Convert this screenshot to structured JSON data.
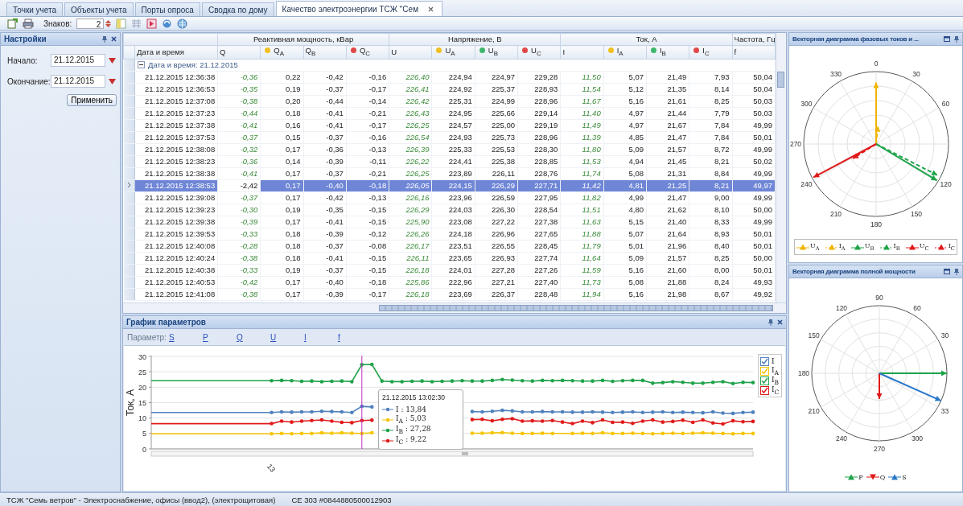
{
  "tabs": [
    {
      "label": "Точки учета",
      "selected": false
    },
    {
      "label": "Объекты учета",
      "selected": false
    },
    {
      "label": "Порты опроса",
      "selected": false
    },
    {
      "label": "Сводка по дому",
      "selected": false
    },
    {
      "label": "Качество электроэнергии ТСЖ \"Сем",
      "selected": true
    }
  ],
  "toolbar": {
    "digits_label": "Знаков:",
    "digits_value": "2"
  },
  "settings": {
    "title": "Настройки",
    "start_label": "Начало:",
    "start_value": "21.12.2015",
    "end_label": "Окончание:",
    "end_value": "21.12.2015",
    "apply": "Применить"
  },
  "table": {
    "key_column": "Дата и время",
    "column_groups": [
      {
        "label": "Реактивная мощность, кВар",
        "columns": [
          {
            "label": "Q",
            "kind": "total"
          },
          {
            "label": "Q$_{A}$",
            "kind": "phase",
            "color": "#f0c020"
          },
          {
            "label": "Q$_{B}$",
            "kind": "phase"
          },
          {
            "label": "Q$_{C}$",
            "kind": "phase",
            "color": "#e04848"
          }
        ]
      },
      {
        "label": "Напряжение, В",
        "columns": [
          {
            "label": "U",
            "kind": "total"
          },
          {
            "label": "U$_{A}$",
            "kind": "phase",
            "color": "#f0c020"
          },
          {
            "label": "U$_{B}$",
            "kind": "phase",
            "color": "#3cb86a"
          },
          {
            "label": "U$_{C}$",
            "kind": "phase",
            "color": "#e04848"
          }
        ]
      },
      {
        "label": "Ток, А",
        "columns": [
          {
            "label": "I",
            "kind": "total"
          },
          {
            "label": "I$_{A}$",
            "kind": "phase",
            "color": "#f0c020"
          },
          {
            "label": "I$_{B}$",
            "kind": "phase",
            "color": "#3cb86a"
          },
          {
            "label": "I$_{C}$",
            "kind": "phase",
            "color": "#e04848"
          }
        ]
      },
      {
        "label": "Частота, Гц",
        "columns": [
          {
            "label": "f",
            "kind": "phase"
          }
        ]
      }
    ],
    "group": {
      "label": "Дата и время: 21.12.2015",
      "expanded": true
    },
    "rows": [
      {
        "time": "21.12.2015 12:36:38",
        "selected": false,
        "values": [
          "-0,36",
          "0,22",
          "-0,42",
          "-0,16",
          "226,40",
          "224,94",
          "224,97",
          "229,28",
          "11,50",
          "5,07",
          "21,49",
          "7,93",
          "50,04"
        ]
      },
      {
        "time": "21.12.2015 12:36:53",
        "selected": false,
        "values": [
          "-0,35",
          "0,19",
          "-0,37",
          "-0,17",
          "226,41",
          "224,92",
          "225,37",
          "228,93",
          "11,54",
          "5,12",
          "21,35",
          "8,14",
          "50,04"
        ]
      },
      {
        "time": "21.12.2015 12:37:08",
        "selected": false,
        "values": [
          "-0,38",
          "0,20",
          "-0,44",
          "-0,14",
          "226,42",
          "225,31",
          "224,99",
          "228,96",
          "11,67",
          "5,16",
          "21,61",
          "8,25",
          "50,03"
        ]
      },
      {
        "time": "21.12.2015 12:37:23",
        "selected": false,
        "values": [
          "-0,44",
          "0,18",
          "-0,41",
          "-0,21",
          "226,43",
          "224,95",
          "225,66",
          "229,14",
          "11,40",
          "4,97",
          "21,44",
          "7,79",
          "50,03"
        ]
      },
      {
        "time": "21.12.2015 12:37:38",
        "selected": false,
        "values": [
          "-0,41",
          "0,16",
          "-0,41",
          "-0,17",
          "226,25",
          "224,57",
          "225,00",
          "229,19",
          "11,49",
          "4,97",
          "21,67",
          "7,84",
          "49,99"
        ]
      },
      {
        "time": "21.12.2015 12:37:53",
        "selected": false,
        "values": [
          "-0,37",
          "0,15",
          "-0,37",
          "-0,16",
          "226,54",
          "224,93",
          "225,73",
          "228,96",
          "11,39",
          "4,85",
          "21,47",
          "7,84",
          "50,01"
        ]
      },
      {
        "time": "21.12.2015 12:38:08",
        "selected": false,
        "values": [
          "-0,32",
          "0,17",
          "-0,36",
          "-0,13",
          "226,39",
          "225,33",
          "225,53",
          "228,30",
          "11,80",
          "5,09",
          "21,57",
          "8,72",
          "49,99"
        ]
      },
      {
        "time": "21.12.2015 12:38:23",
        "selected": false,
        "values": [
          "-0,36",
          "0,14",
          "-0,39",
          "-0,11",
          "226,22",
          "224,41",
          "225,38",
          "228,85",
          "11,53",
          "4,94",
          "21,45",
          "8,21",
          "50,02"
        ]
      },
      {
        "time": "21.12.2015 12:38:38",
        "selected": false,
        "values": [
          "-0,41",
          "0,17",
          "-0,37",
          "-0,21",
          "226,25",
          "223,89",
          "226,11",
          "228,76",
          "11,74",
          "5,08",
          "21,31",
          "8,84",
          "49,99"
        ]
      },
      {
        "time": "21.12.2015 12:38:53",
        "selected": true,
        "values": [
          "-2,42",
          "0,17",
          "-0,40",
          "-0,18",
          "226,05",
          "224,15",
          "226,29",
          "227,71",
          "11,42",
          "4,81",
          "21,25",
          "8,21",
          "49,97"
        ]
      },
      {
        "time": "21.12.2015 12:39:08",
        "selected": false,
        "values": [
          "-0,37",
          "0,17",
          "-0,42",
          "-0,13",
          "226,16",
          "223,96",
          "226,59",
          "227,95",
          "11,82",
          "4,99",
          "21,47",
          "9,00",
          "49,99"
        ]
      },
      {
        "time": "21.12.2015 12:39:23",
        "selected": false,
        "values": [
          "-0,30",
          "0,19",
          "-0,35",
          "-0,15",
          "226,29",
          "224,03",
          "226,30",
          "228,54",
          "11,51",
          "4,80",
          "21,62",
          "8,10",
          "50,00"
        ]
      },
      {
        "time": "21.12.2015 12:39:38",
        "selected": false,
        "values": [
          "-0,39",
          "0,17",
          "-0,41",
          "-0,15",
          "225,90",
          "223,08",
          "227,22",
          "227,38",
          "11,63",
          "5,15",
          "21,40",
          "8,33",
          "49,99"
        ]
      },
      {
        "time": "21.12.2015 12:39:53",
        "selected": false,
        "values": [
          "-0,33",
          "0,18",
          "-0,39",
          "-0,12",
          "226,26",
          "224,18",
          "226,96",
          "227,65",
          "11,88",
          "5,07",
          "21,64",
          "8,93",
          "50,01"
        ]
      },
      {
        "time": "21.12.2015 12:40:08",
        "selected": false,
        "values": [
          "-0,28",
          "0,18",
          "-0,37",
          "-0,08",
          "226,17",
          "223,51",
          "226,55",
          "228,45",
          "11,79",
          "5,01",
          "21,96",
          "8,40",
          "50,01"
        ]
      },
      {
        "time": "21.12.2015 12:40:24",
        "selected": false,
        "values": [
          "-0,38",
          "0,18",
          "-0,41",
          "-0,15",
          "226,11",
          "223,65",
          "226,93",
          "227,74",
          "11,64",
          "5,09",
          "21,57",
          "8,25",
          "50,00"
        ]
      },
      {
        "time": "21.12.2015 12:40:38",
        "selected": false,
        "values": [
          "-0,33",
          "0,19",
          "-0,37",
          "-0,15",
          "226,18",
          "224,01",
          "227,28",
          "227,26",
          "11,59",
          "5,16",
          "21,60",
          "8,00",
          "50,01"
        ]
      },
      {
        "time": "21.12.2015 12:40:53",
        "selected": false,
        "values": [
          "-0,42",
          "0,17",
          "-0,40",
          "-0,18",
          "225,86",
          "222,96",
          "227,21",
          "227,40",
          "11,73",
          "5,08",
          "21,88",
          "8,24",
          "49,93"
        ]
      },
      {
        "time": "21.12.2015 12:41:08",
        "selected": false,
        "values": [
          "-0,38",
          "0,17",
          "-0,39",
          "-0,17",
          "226,18",
          "223,69",
          "226,37",
          "228,48",
          "11,94",
          "5,16",
          "21,98",
          "8,67",
          "49,92"
        ]
      }
    ]
  },
  "chart_panel": {
    "title": "График параметров",
    "param_label": "Параметр:",
    "params": [
      "S",
      "P",
      "Q",
      "U",
      "I",
      "f"
    ],
    "chart_data": {
      "type": "line",
      "ylabel": "Ток, А",
      "ylim": [
        0,
        30
      ],
      "yticks": [
        0,
        5,
        10,
        15,
        20,
        25,
        30
      ],
      "grid": true,
      "legend": "right",
      "series": [
        {
          "name": "I",
          "color": "#4f81bd",
          "values": [
            11.8,
            11.8,
            11.8,
            11.8,
            11.8,
            11.8,
            11.8,
            11.8,
            11.8,
            11.8,
            11.8,
            11.8,
            11.8,
            12.0,
            11.9,
            12.0,
            12.0,
            12.2,
            12.1,
            12.0,
            11.8,
            13.8,
            13.6,
            null,
            null,
            null,
            null,
            null,
            null,
            null,
            null,
            null,
            12.1,
            12.0,
            12.2,
            12.5,
            12.3,
            12.0,
            12.0,
            12.1,
            12.0,
            12.0,
            11.9,
            11.9,
            12.0,
            11.9,
            11.8,
            11.9,
            12.0,
            11.8,
            11.9,
            12.0,
            11.8,
            11.9,
            11.8,
            11.7,
            12.0,
            11.6,
            11.5,
            11.8,
            11.9
          ]
        },
        {
          "name": "I$_{A}$",
          "color": "#f5c400",
          "values": [
            4.9,
            4.9,
            4.9,
            4.9,
            4.9,
            4.9,
            4.9,
            4.9,
            4.9,
            4.9,
            4.9,
            4.9,
            4.9,
            5.0,
            4.9,
            5.0,
            5.0,
            5.2,
            5.1,
            5.2,
            5.1,
            5.0,
            5.2,
            null,
            null,
            null,
            null,
            null,
            null,
            null,
            null,
            null,
            5.1,
            5.1,
            5.2,
            5.3,
            5.1,
            5.0,
            5.0,
            5.1,
            5.0,
            5.0,
            5.0,
            5.1,
            5.0,
            5.2,
            5.0,
            5.0,
            5.1,
            5.0,
            4.9,
            5.0,
            5.1,
            5.0,
            5.1,
            5.2,
            5.1,
            5.0,
            4.9,
            5.0,
            5.0
          ]
        },
        {
          "name": "I$_{B}$",
          "color": "#1fa34a",
          "values": [
            22.1,
            22.1,
            22.1,
            22.1,
            22.1,
            22.1,
            22.1,
            22.1,
            22.1,
            22.1,
            22.1,
            22.1,
            22.1,
            22.2,
            22.1,
            21.9,
            22.0,
            21.8,
            21.9,
            22.0,
            21.8,
            27.3,
            27.4,
            22.0,
            21.8,
            21.8,
            21.9,
            22.0,
            21.8,
            21.9,
            22.0,
            22.1,
            22.0,
            22.0,
            22.2,
            22.5,
            22.3,
            22.1,
            22.0,
            22.2,
            22.1,
            22.2,
            22.1,
            22.0,
            22.0,
            22.2,
            21.9,
            22.1,
            22.2,
            22.2,
            21.3,
            21.5,
            21.8,
            21.6,
            21.3,
            21.3,
            21.6,
            21.8,
            21.2,
            21.6,
            21.5
          ]
        },
        {
          "name": "I$_{C}$",
          "color": "#e01a1a",
          "values": [
            8.2,
            8.2,
            8.2,
            8.2,
            8.2,
            8.2,
            8.2,
            8.2,
            8.2,
            8.2,
            8.2,
            8.2,
            8.2,
            9.0,
            8.7,
            9.0,
            9.2,
            9.4,
            9.0,
            8.6,
            8.5,
            9.2,
            9.3,
            null,
            null,
            null,
            null,
            null,
            null,
            null,
            null,
            null,
            9.5,
            9.6,
            9.1,
            9.6,
            9.8,
            9.0,
            9.1,
            9.0,
            9.2,
            8.7,
            8.2,
            9.0,
            8.5,
            9.4,
            8.6,
            8.7,
            8.3,
            9.0,
            9.4,
            8.7,
            8.9,
            9.3,
            8.6,
            9.4,
            8.4,
            8.1,
            9.1,
            8.8,
            8.9
          ]
        }
      ],
      "annotations": [
        {
          "text": "13"
        }
      ]
    },
    "legend": [
      {
        "checked": true
      },
      {
        "checked": true
      },
      {
        "checked": true
      },
      {
        "checked": true
      }
    ],
    "tooltip": {
      "title": "21.12.2015 13:02:30",
      "items": [
        {
          "label": "I : 13,84",
          "color": "#4f81bd"
        },
        {
          "label": "I$_{A}$ : 5,03",
          "color": "#f5c400"
        },
        {
          "label": "I$_{B}$ : 27,28",
          "color": "#1fa34a"
        },
        {
          "label": "I$_{C}$ : 9,22",
          "color": "#e01a1a"
        }
      ]
    }
  },
  "phase_diagram": {
    "title": "Векторная диаграмма фазовых токов и ...",
    "angle_labels": [
      "0",
      "30",
      "60",
      "120",
      "150",
      "180",
      "210",
      "240",
      "270",
      "300",
      "330"
    ],
    "legend": [
      {
        "label": "U$_{A}$",
        "color": "#f0b400",
        "kind": "solid"
      },
      {
        "label": "I$_{A}$",
        "color": "#f0b400",
        "kind": "dashed"
      },
      {
        "label": "U$_{B}$",
        "color": "#1fa34a",
        "kind": "solid"
      },
      {
        "label": "I$_{B}$",
        "color": "#1fa34a",
        "kind": "dashed"
      },
      {
        "label": "U$_{C}$",
        "color": "#e01a1a",
        "kind": "solid"
      },
      {
        "label": "I$_{C}$",
        "color": "#e01a1a",
        "kind": "dashed"
      }
    ]
  },
  "power_diagram": {
    "title": "Векторная диаграмма полной мощности",
    "angle_labels": [
      "90",
      "60",
      "30",
      "33",
      "300",
      "270",
      "240",
      "210",
      "180",
      "150",
      "120"
    ],
    "legend": [
      {
        "label": "P",
        "color": "#1fa34a",
        "kind": "up"
      },
      {
        "label": "Q",
        "color": "#e01a1a",
        "kind": "down"
      },
      {
        "label": "S",
        "color": "#2a78c8",
        "kind": "up"
      }
    ]
  },
  "status_bar": [
    "ТСЖ \"Семь ветров\" - Электроснабжение, офисы (ввод2), (электрощитовая)",
    "СЕ 303 #0844880500012903"
  ]
}
